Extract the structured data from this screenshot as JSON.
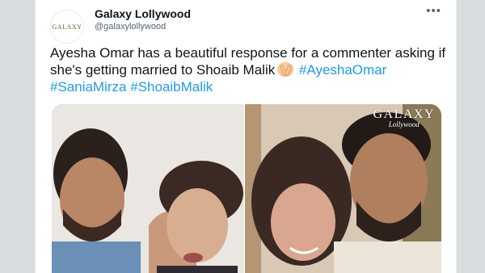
{
  "tweet": {
    "account_name": "Galaxy Lollywood",
    "handle": "@galaxylollywood",
    "avatar_text": "GALAXY",
    "more_label": "•••",
    "text_main": "Ayesha Omar has a beautiful response for a commenter asking if she's getting married to Shoaib Malik",
    "emoji": "clapping-hands",
    "hashtags": [
      "#AyeshaOmar",
      "#SaniaMirza",
      "#ShoaibMalik"
    ]
  },
  "media": {
    "watermark_line1": "GALAXY",
    "watermark_line2": "Lollywood",
    "photos": [
      "photo-shoaib-ayesha",
      "photo-sania-shoaib"
    ]
  },
  "colors": {
    "link": "#1d9bf0",
    "text": "#0f1419",
    "secondary": "#536471"
  }
}
